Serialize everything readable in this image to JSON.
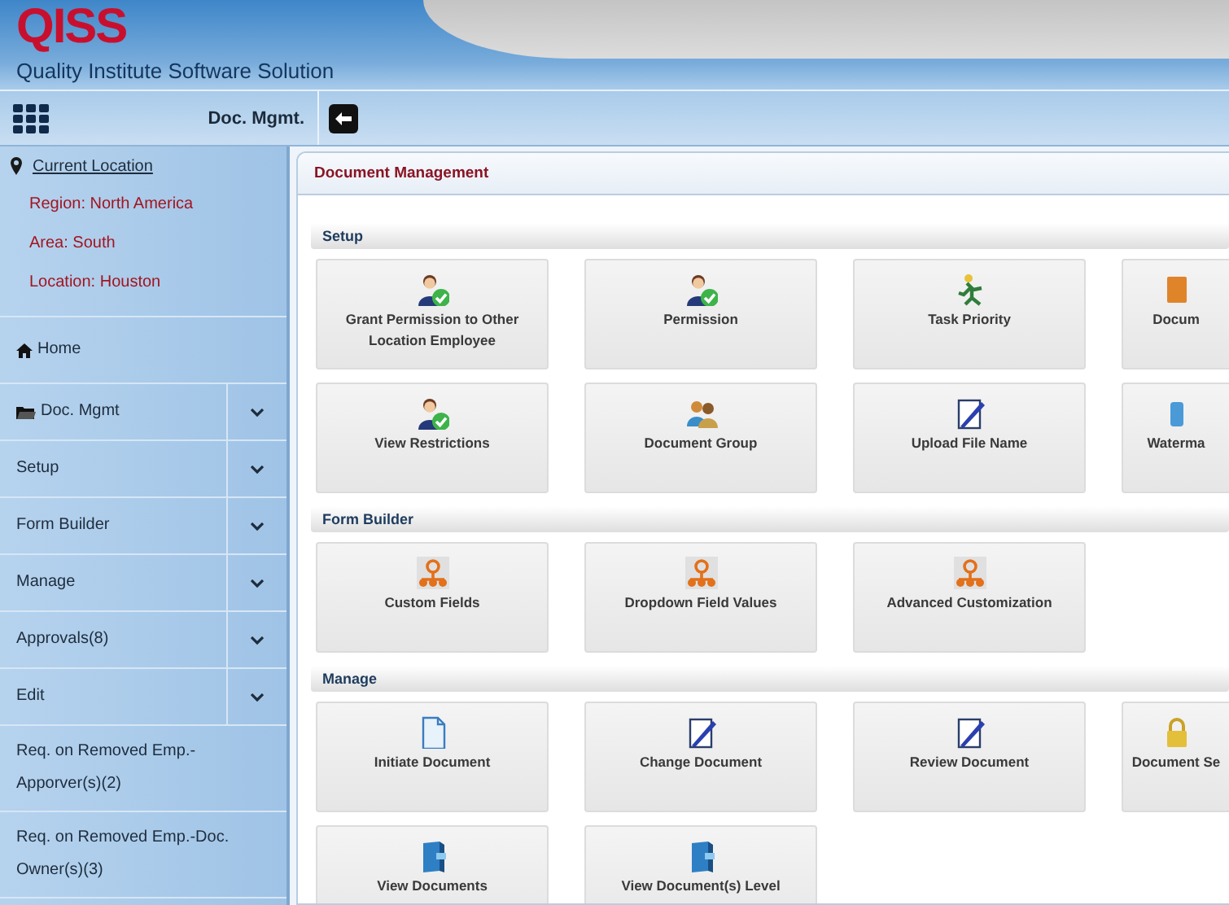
{
  "header": {
    "logo": "QISS",
    "subtitle": "Quality Institute Software Solution"
  },
  "toolbar": {
    "module": "Doc. Mgmt."
  },
  "sidebar": {
    "location_link": "Current Location",
    "location": [
      {
        "label": "Region:",
        "value": "North America"
      },
      {
        "label": "Area:",
        "value": "South"
      },
      {
        "label": "Location:",
        "value": "Houston"
      }
    ],
    "items": [
      {
        "label": "Home",
        "kind": "home"
      },
      {
        "label": "Doc. Mgmt",
        "kind": "module"
      },
      {
        "label": "Setup",
        "kind": "dropdown"
      },
      {
        "label": "Form Builder",
        "kind": "dropdown"
      },
      {
        "label": "Manage",
        "kind": "dropdown"
      },
      {
        "label": "Approvals(8)",
        "kind": "dropdown"
      },
      {
        "label": "Edit",
        "kind": "dropdown"
      },
      {
        "label": "Req. on Removed Emp.-Apporver(s)(2)",
        "kind": "link"
      },
      {
        "label": "Req. on Removed Emp.-Doc. Owner(s)(3)",
        "kind": "link"
      }
    ]
  },
  "main": {
    "title": "Document Management",
    "sections": [
      {
        "title": "Setup",
        "tiles": [
          {
            "label": "Grant Permission to Other Location Employee",
            "kind": "user"
          },
          {
            "label": "Permission",
            "kind": "user"
          },
          {
            "label": "Task Priority",
            "kind": "runner"
          },
          {
            "label": "Docum",
            "kind": "box"
          },
          {
            "label": "View Restrictions",
            "kind": "user"
          },
          {
            "label": "Document Group",
            "kind": "group"
          },
          {
            "label": "Upload File Name",
            "kind": "pen"
          },
          {
            "label": "Waterma",
            "kind": "tag"
          }
        ]
      },
      {
        "title": "Form Builder",
        "tiles": [
          {
            "label": "Custom Fields",
            "kind": "org"
          },
          {
            "label": "Dropdown Field Values",
            "kind": "org"
          },
          {
            "label": "Advanced Customization",
            "kind": "org"
          }
        ]
      },
      {
        "title": "Manage",
        "tiles": [
          {
            "label": "Initiate Document",
            "kind": "page"
          },
          {
            "label": "Change Document",
            "kind": "pen"
          },
          {
            "label": "Review Document",
            "kind": "pen"
          },
          {
            "label": "Document Se",
            "kind": "lock"
          },
          {
            "label": "View Documents",
            "kind": "book"
          },
          {
            "label": "View Document(s) Level",
            "kind": "book"
          }
        ]
      }
    ]
  }
}
